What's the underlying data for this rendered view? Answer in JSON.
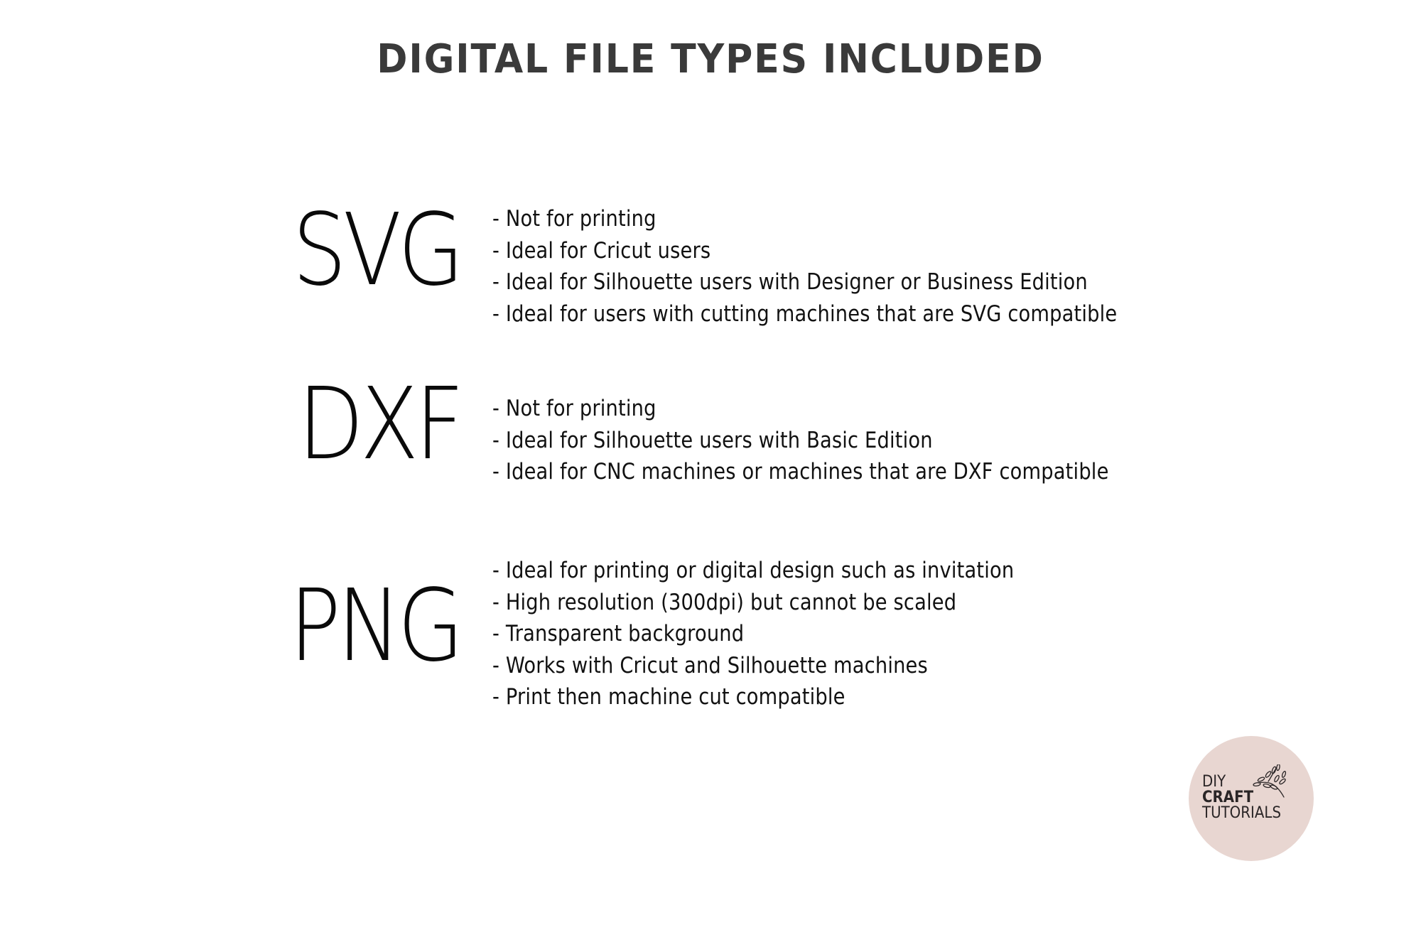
{
  "title": "DIGITAL FILE TYPES INCLUDED",
  "file_types": [
    {
      "label": "SVG",
      "bullets": [
        "- Not for printing",
        "- Ideal for Cricut users",
        "- Ideal for Silhouette users with Designer or Business Edition",
        "- Ideal for users with cutting machines that are SVG compatible"
      ]
    },
    {
      "label": "DXF",
      "bullets": [
        "- Not for printing",
        "- Ideal for Silhouette users with Basic Edition",
        "- Ideal for CNC machines or machines that are DXF compatible"
      ]
    },
    {
      "label": "PNG",
      "bullets": [
        "- Ideal for printing or digital design such as invitation",
        "- High resolution (300dpi) but cannot be scaled",
        "- Transparent background",
        "- Works with Cricut and Silhouette machines",
        "- Print then machine cut compatible"
      ]
    }
  ],
  "logo": {
    "line1": "DIY",
    "line2": "CRAFT",
    "line3": "TUTORIALS",
    "icon": "leaf-sprig-icon",
    "background_color": "#e8d6d1",
    "text_color": "#2a2526"
  },
  "colors": {
    "title": "#3a3a3a",
    "text": "#111111",
    "background": "#ffffff"
  }
}
